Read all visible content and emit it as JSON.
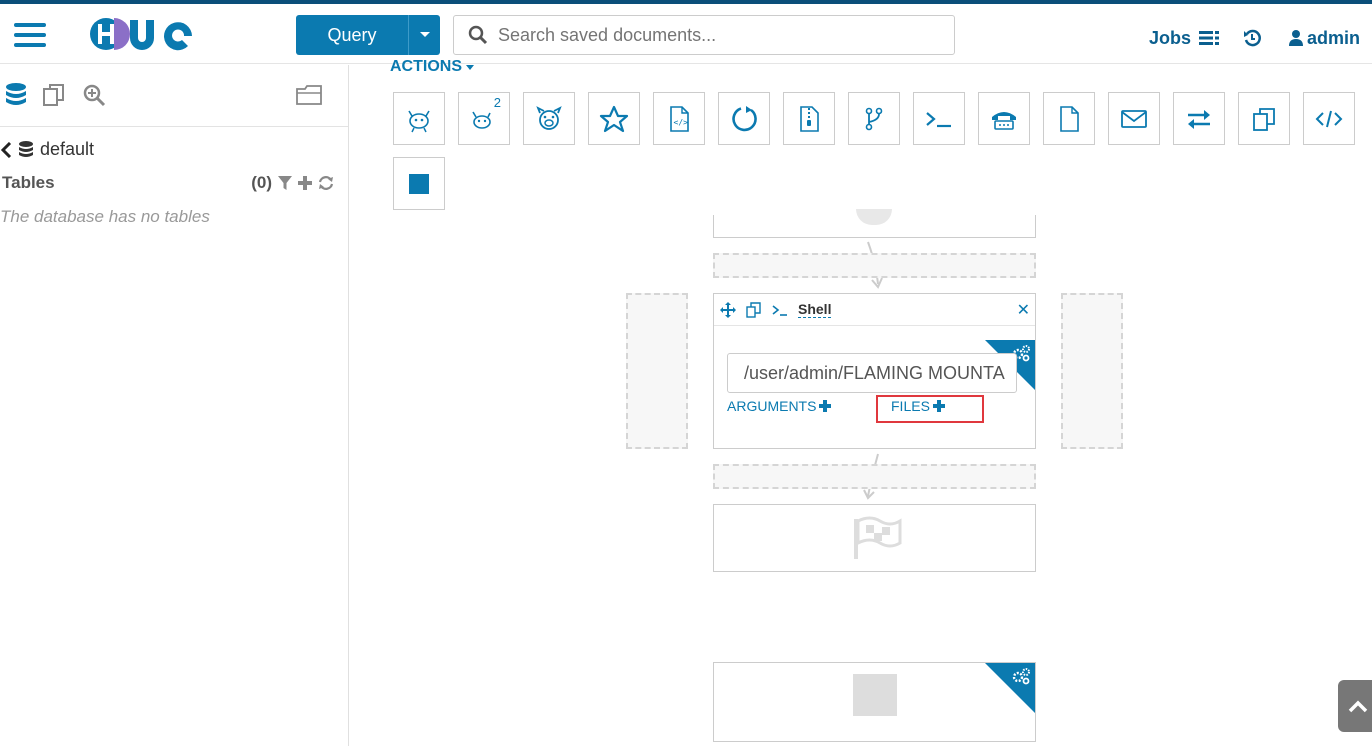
{
  "brand": {
    "logo_text": "HUE",
    "primary": "#0b7ab0",
    "topbar": "#0b4f7a"
  },
  "navbar": {
    "query_label": "Query",
    "search_placeholder": "Search saved documents...",
    "jobs_label": "Jobs",
    "user_label": "admin"
  },
  "sidebar": {
    "database": "default",
    "tables_label": "Tables",
    "tables_count": "(0)",
    "empty_text": "The database has no tables"
  },
  "editor": {
    "actions_label": "ACTIONS",
    "action_icons": [
      "hive-icon",
      "hive2-icon",
      "impala-icon",
      "pig-icon",
      "java-icon",
      "sqoop-icon",
      "mapreduce-icon",
      "subworkflow-icon",
      "shell-icon",
      "ssh-icon",
      "hdfs-fs-icon",
      "email-icon",
      "streaming-icon",
      "distcp-icon",
      "spark-icon",
      "kill-icon"
    ],
    "hive2_badge": "2",
    "shell_node": {
      "title": "Shell",
      "command_value": "/user/admin/FLAMING MOUNTA",
      "arguments_label": "ARGUMENTS",
      "files_label": "FILES"
    }
  }
}
